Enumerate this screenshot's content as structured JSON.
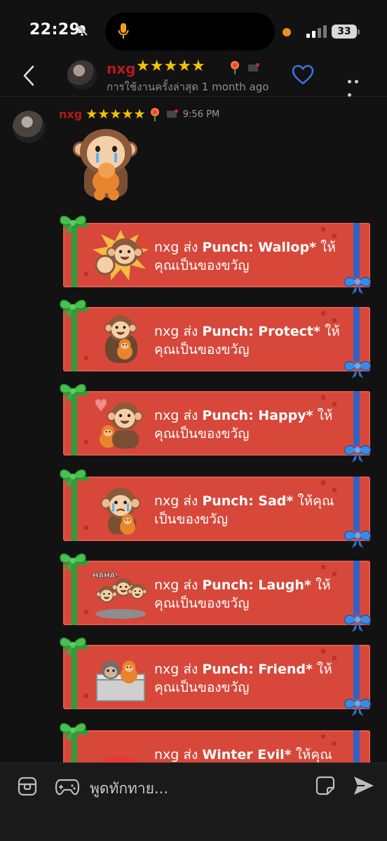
{
  "status_bar": {
    "time": "22:29",
    "battery": "33"
  },
  "header": {
    "name": "nxg",
    "stars": [
      "★",
      "★",
      "★",
      "★",
      "★"
    ],
    "last_seen": "การใช้งานครั้งล่าสุด 1 month ago"
  },
  "message": {
    "sender": "nxg",
    "stars": [
      "★",
      "★",
      "★",
      "★",
      "★"
    ],
    "time": "9:56 PM"
  },
  "gifts": [
    {
      "prefix": "nxg ส่ง ",
      "item": "Punch: Wallop*",
      "suffix": " ให้คุณเป็นของขวัญ"
    },
    {
      "prefix": "nxg ส่ง ",
      "item": "Punch: Protect*",
      "suffix": " ให้คุณเป็นของขวัญ"
    },
    {
      "prefix": "nxg ส่ง ",
      "item": "Punch: Happy*",
      "suffix": " ให้คุณเป็นของขวัญ"
    },
    {
      "prefix": "nxg ส่ง ",
      "item": "Punch: Sad*",
      "suffix": " ให้คุณเป็นของขวัญ"
    },
    {
      "prefix": "nxg ส่ง ",
      "item": "Punch: Laugh*",
      "suffix": " ให้คุณเป็นของขวัญ"
    },
    {
      "prefix": "nxg ส่ง ",
      "item": "Punch: Friend*",
      "suffix": " ให้คุณเป็นของขวัญ"
    },
    {
      "prefix": "nxg ส่ง ",
      "item": "Winter Evil*",
      "suffix": " ให้คุณเป็น"
    }
  ],
  "gift_badge_text": "HAHA!",
  "composer": {
    "placeholder": "พูดทักทาย..."
  },
  "colors": {
    "background": "#121212",
    "username": "#b51b1b",
    "gift_card": "#d7473a",
    "ribbon_green": "#2f9c3b",
    "ribbon_blue": "#2f63c7",
    "heart_outline": "#3a73d9"
  },
  "icons": [
    "microphone-icon",
    "bell-slash-icon",
    "chevron-left-icon",
    "heart-icon",
    "more-icon",
    "rose-icon",
    "flag-icon",
    "gift-icon",
    "gamepad-icon",
    "sticker-icon",
    "send-icon"
  ]
}
